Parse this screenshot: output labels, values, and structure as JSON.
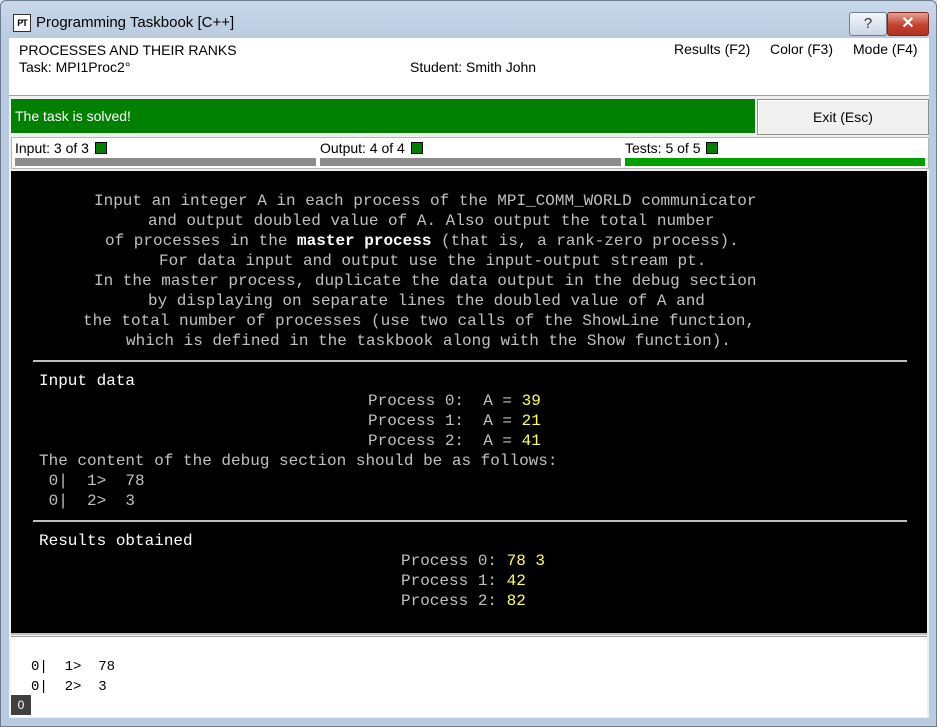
{
  "window": {
    "icon_text": "PT",
    "title": "Programming Taskbook [C++]",
    "help_glyph": "?",
    "close_glyph": "✕"
  },
  "header": {
    "group_title": "PROCESSES AND THEIR RANKS",
    "task_label": "Task: MPI1Proc2°",
    "student_label": "Student: Smith John",
    "menu": [
      "Results (F2)",
      "Color (F3)",
      "Mode (F4)"
    ]
  },
  "status": {
    "message": "The task is solved!",
    "exit_label": "Exit (Esc)",
    "color": "#008000"
  },
  "progress": [
    {
      "label": "Input: 3 of 3",
      "fill": 1.0,
      "state": "gray"
    },
    {
      "label": "Output: 4 of 4",
      "fill": 1.0,
      "state": "gray"
    },
    {
      "label": "Tests: 5 of 5",
      "fill": 1.0,
      "state": "green"
    }
  ],
  "task_text": {
    "l1": "Input an integer A in each process of the MPI_COMM_WORLD communicator",
    "l2": "and output doubled value of A. Also output the total number",
    "l3_pre": "of processes in the ",
    "l3_bold": "master process",
    "l3_post": " (that is, a rank-zero process).",
    "l4": "For data input and output use the input-output stream pt.",
    "l5": "In the master process, duplicate the data output in the debug section",
    "l6": "by displaying on separate lines the doubled value of A and",
    "l7": "the total number of processes (use two calls of the ShowLine function,",
    "l8": "which is defined in the taskbook along with the Show function)."
  },
  "input_section": {
    "heading": "Input data",
    "rows": [
      {
        "label": "Process 0:  A = ",
        "value": "39"
      },
      {
        "label": "Process 1:  A = ",
        "value": "21"
      },
      {
        "label": "Process 2:  A = ",
        "value": "41"
      }
    ],
    "debug_caption": "The content of the debug section should be as follows:",
    "debug_lines": [
      " 0|  1>  78",
      " 0|  2>  3"
    ]
  },
  "results_section": {
    "heading": "Results obtained",
    "rows": [
      {
        "label": "Process 0: ",
        "value": "78 3"
      },
      {
        "label": "Process 1: ",
        "value": "42"
      },
      {
        "label": "Process 2: ",
        "value": "82"
      }
    ]
  },
  "debug_panel": {
    "lines": [
      "0|  1>  78",
      "0|  2>  3"
    ],
    "page": "0"
  }
}
